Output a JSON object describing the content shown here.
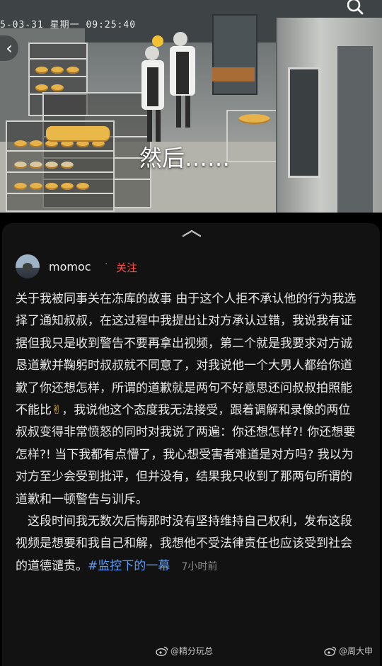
{
  "video": {
    "timestamp": "5-03-31 星期一 09:25:40",
    "caption": "然后……"
  },
  "post": {
    "username": "momoc",
    "separator": "·",
    "follow_label": "关注",
    "paragraph1_a": "关于我被同事关在冻库的故事 由于这个人拒不承认他的行为我选择了通知叔叔，在这过程中我提出让对方承认过错，我说我有证据但我只是收到警告不要再拿出视频，第二个就是我要求对方诚恳道歉并鞠躬时叔叔就不同意了，对我说他一个大男人都给你道歉了你还想怎样，所谓的道歉就是两句不好意思还问叔叔拍照能不能比",
    "emoji": "✌",
    "paragraph1_b": "，我说他这个态度我无法接受，跟着调解和录像的两位叔叔变得非常愤怒的同时对我说了两遍：你还想怎样?! 你还想要怎样?! 当下我都有点懵了，我心想受害者难道是对方吗? 我以为对方至少会受到批评，但并没有，结果我只收到了那两句所谓的道歉和一顿警告与训斥。",
    "paragraph2": "这段时间我无数次后悔那时没有坚持维持自己权利，发布这段视频是想要和我自己和解，我想他不受法律责任也应该受到社会的道德谴责。",
    "hashtag": "#监控下的一幕",
    "time": "7小时前"
  },
  "watermarks": {
    "left": "@精分玩总",
    "right": "@周大申"
  },
  "icons": {
    "back": "chevron-left-icon",
    "search": "search-icon",
    "handle": "chevron-up-icon",
    "weibo": "weibo-logo-icon"
  },
  "colors": {
    "follow": "#ff4d4d",
    "hashtag": "#5d9bf5",
    "sheet_bg": "#121212"
  }
}
